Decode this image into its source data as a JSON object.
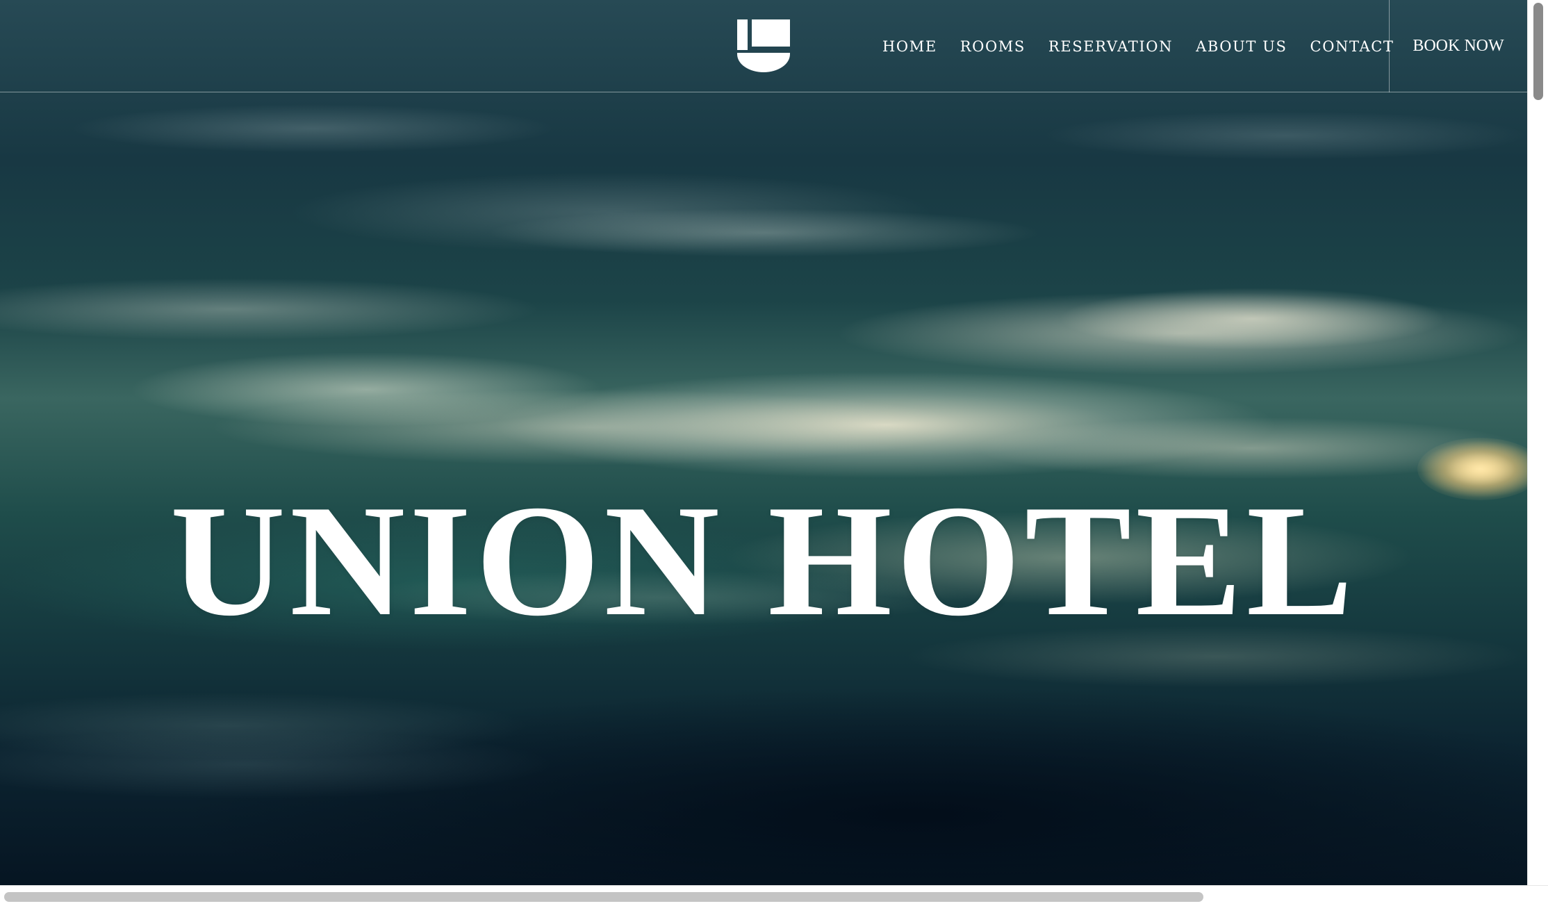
{
  "header": {
    "logo_icon": "hotel-u-logo-icon",
    "nav": {
      "home": "HOME",
      "rooms": "ROOMS",
      "reservation": "RESERVATION",
      "about_us": "ABOUT US",
      "contact": "CONTACT"
    },
    "book_now": "BOOK NOW"
  },
  "hero": {
    "title": "UNION HOTEL",
    "background": "water-ripples-image"
  },
  "colors": {
    "text": "#ffffff",
    "water_dark": "#0c2431",
    "water_teal": "#1f4d4b",
    "water_highlight": "#f3ecd4"
  }
}
